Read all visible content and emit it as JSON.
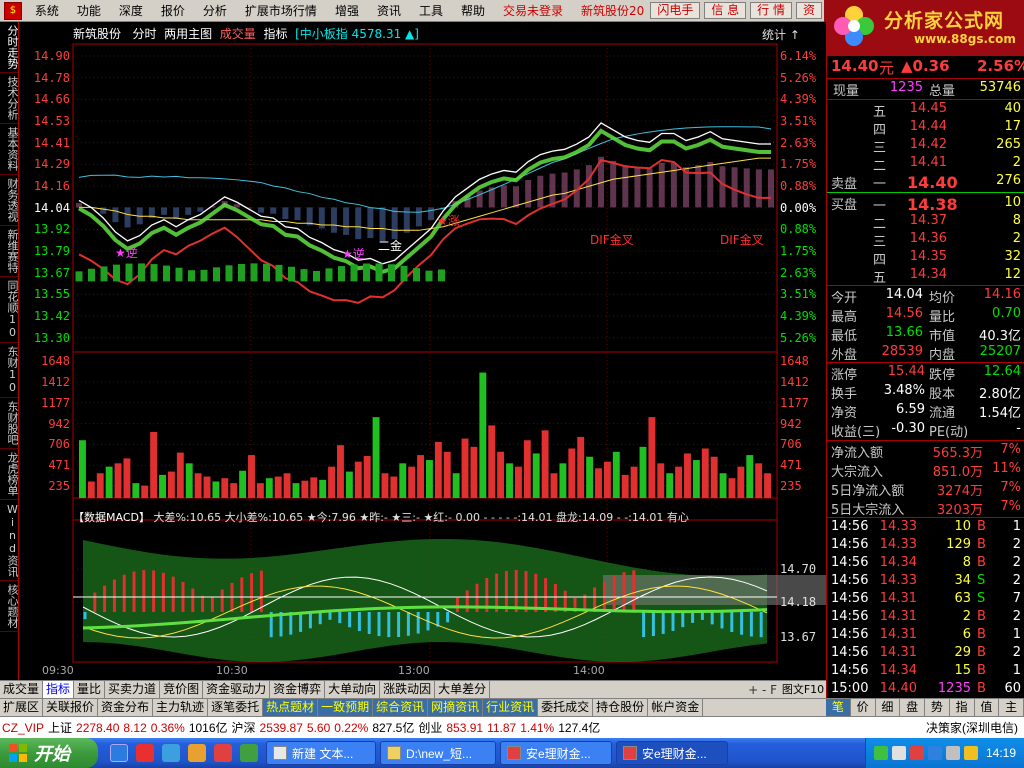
{
  "menubar": {
    "items": [
      "系统",
      "功能",
      "深度",
      "报价",
      "分析",
      "扩展市场行情",
      "增强",
      "资讯",
      "工具",
      "帮助"
    ],
    "trade_status": "交易未登录",
    "stock_tab": "新筑股份",
    "stock_tab_suffix": "20",
    "buttons": [
      "闪电手",
      "信 息",
      "行 情",
      "资"
    ]
  },
  "brand": {
    "title": "分析家公式网",
    "url": "www.88gs.com"
  },
  "leftnav": {
    "tabs": [
      "分时走势",
      "技术分析",
      "基本资料",
      "财务透视",
      "新维赛特",
      "同花顺10",
      "东财10",
      "东财股吧",
      "龙虎榜单",
      "Wind资讯",
      "核心题材"
    ]
  },
  "chart_header": {
    "stock": "新筑股份",
    "items": [
      "分时",
      "两用主图",
      "成交量",
      "指标"
    ],
    "index": "[中小板指 4578.31 ▲]",
    "stats": "统计 ↑"
  },
  "chart_data": {
    "type": "line",
    "price_axis": [
      "14.90",
      "14.78",
      "14.66",
      "14.53",
      "14.41",
      "14.29",
      "14.16",
      "14.04",
      "13.92",
      "13.79",
      "13.67",
      "13.55",
      "13.42",
      "13.30"
    ],
    "pct_axis": [
      "6.14%",
      "5.26%",
      "4.39%",
      "3.51%",
      "2.63%",
      "1.75%",
      "0.88%",
      "0.00%",
      "0.88%",
      "1.75%",
      "2.63%",
      "3.51%",
      "4.39%",
      "5.26%"
    ],
    "volume_axis": [
      "1648",
      "1412",
      "1177",
      "942",
      "706",
      "471",
      "235"
    ],
    "macd_axis": [
      "14.70",
      "14.18",
      "13.67"
    ],
    "time_labels": [
      "09:30",
      "10:30",
      "13:00",
      "14:00"
    ],
    "prev_close": 14.04,
    "price_series": [
      14.08,
      14.04,
      13.98,
      13.9,
      13.85,
      13.88,
      13.94,
      13.97,
      13.93,
      13.97,
      14.0,
      14.05,
      14.1,
      14.07,
      14.03,
      13.99,
      13.98,
      13.93,
      13.92,
      13.87,
      13.84,
      13.8,
      13.78,
      13.74,
      13.75,
      13.72,
      13.74,
      13.8,
      13.86,
      13.92,
      14.02,
      14.1,
      14.15,
      14.2,
      14.23,
      14.25,
      14.24,
      14.3,
      14.34,
      14.36,
      14.37,
      14.4,
      14.44,
      14.52,
      14.48,
      14.44,
      14.42,
      14.41,
      14.46,
      14.46,
      14.42,
      14.44,
      14.47,
      14.43,
      14.42,
      14.41,
      14.4,
      14.4
    ],
    "avg_series": [
      14.04,
      14.04,
      14.03,
      14.02,
      14.0,
      13.99,
      13.99,
      13.98,
      13.98,
      13.97,
      13.97,
      13.97,
      13.97,
      13.97,
      13.97,
      13.97,
      13.96,
      13.96,
      13.95,
      13.95,
      13.94,
      13.94,
      13.93,
      13.93,
      13.92,
      13.92,
      13.91,
      13.91,
      13.91,
      13.92,
      13.93,
      13.95,
      13.97,
      13.99,
      14.01,
      14.03,
      14.05,
      14.07,
      14.09,
      14.11,
      14.12,
      14.14,
      14.16,
      14.18,
      14.2,
      14.21,
      14.22,
      14.23,
      14.24,
      14.25,
      14.26,
      14.27,
      14.28,
      14.29,
      14.3,
      14.31,
      14.32,
      14.32
    ],
    "annotations": [
      "★逆",
      "★逆",
      "二金",
      "★涨",
      "DIF金叉",
      "DIF金叉"
    ],
    "volume_bars": [
      700,
      200,
      300,
      380,
      420,
      480,
      180,
      150,
      800,
      280,
      320,
      550,
      420,
      300,
      260,
      200,
      240,
      180,
      330,
      520,
      180,
      240,
      260,
      300,
      180,
      210,
      250,
      220,
      380,
      640,
      320,
      440,
      510,
      980,
      300,
      260,
      420,
      380,
      520,
      460,
      680,
      560,
      300,
      720,
      620,
      1520,
      880,
      560,
      420,
      380,
      700,
      540,
      820,
      300,
      420,
      600,
      740,
      500,
      360,
      440,
      560,
      280,
      380,
      620,
      980,
      420,
      300,
      380,
      540,
      460,
      600,
      500,
      300,
      240,
      380,
      520,
      420,
      300
    ],
    "macd_header": {
      "title": "【数据MACD】",
      "items": [
        "大差%:10.65",
        "大小差%:10.65",
        "★今:7.96",
        "★昨:-",
        "★三:-",
        "★红:-",
        "0.00",
        "-",
        "-",
        "-",
        "-",
        "-:14.01",
        "盘龙:14.09",
        "-",
        "-:14.01",
        "有心"
      ]
    }
  },
  "bottom_tabs_1": [
    "成交量",
    "指标",
    "量比",
    "买卖力道",
    "竞价图",
    "资金驱动力",
    "资金博弈",
    "大单动向",
    "涨跌动因",
    "大单差分"
  ],
  "bottom_tabs_1_nav": "+ - F",
  "bottom_tabs_2": [
    "扩展区",
    "关联报价",
    "资金分布",
    "主力轨迹",
    "逐笔委托",
    "热点题材",
    "一致预期",
    "综合资讯",
    "网摘资讯",
    "行业资讯",
    "委托成交",
    "持仓股份",
    "帐户资金"
  ],
  "quote": {
    "price": "14.40",
    "unit": "元",
    "change": "▲0.36",
    "pct": "2.56%",
    "now_vol_label": "现量",
    "now_vol": "1235",
    "total_vol_label": "总量",
    "total_vol": "53746",
    "asks": [
      {
        "label": "五",
        "price": "14.45",
        "vol": "40"
      },
      {
        "label": "四",
        "price": "14.44",
        "vol": "17"
      },
      {
        "label": "三",
        "price": "14.42",
        "vol": "265"
      },
      {
        "label": "二",
        "price": "14.41",
        "vol": "2"
      },
      {
        "label": "一",
        "price": "14.40",
        "vol": "276"
      }
    ],
    "bids": [
      {
        "label": "一",
        "price": "14.38",
        "vol": "10"
      },
      {
        "label": "二",
        "price": "14.37",
        "vol": "8"
      },
      {
        "label": "三",
        "price": "14.36",
        "vol": "2"
      },
      {
        "label": "四",
        "price": "14.35",
        "vol": "32"
      },
      {
        "label": "五",
        "price": "14.34",
        "vol": "12"
      }
    ],
    "ask_label": "卖盘",
    "bid_label": "买盘",
    "stats": [
      [
        "今开",
        "14.04",
        "均价",
        "14.16"
      ],
      [
        "最高",
        "14.56",
        "量比",
        "0.70"
      ],
      [
        "最低",
        "13.66",
        "市值",
        "40.3亿"
      ],
      [
        "外盘",
        "28539",
        "内盘",
        "25207"
      ]
    ],
    "stats2": [
      [
        "涨停",
        "15.44",
        "跌停",
        "12.64"
      ],
      [
        "换手",
        "3.48%",
        "股本",
        "2.80亿"
      ],
      [
        "净资",
        "6.59",
        "流通",
        "1.54亿"
      ],
      [
        "收益(三)",
        "-0.30",
        "PE(动)",
        "-"
      ]
    ],
    "flows": [
      [
        "净流入额",
        "565.3万",
        "7%"
      ],
      [
        "大宗流入",
        "851.0万",
        "11%"
      ],
      [
        "5日净流入额",
        "3274万",
        "7%"
      ],
      [
        "5日大宗流入",
        "3203万",
        "7%"
      ]
    ],
    "ticks": [
      [
        "14:56",
        "14.33",
        "10",
        "B",
        "1"
      ],
      [
        "14:56",
        "14.33",
        "129",
        "B",
        "2"
      ],
      [
        "14:56",
        "14.34",
        "8",
        "B",
        "2"
      ],
      [
        "14:56",
        "14.33",
        "34",
        "S",
        "2"
      ],
      [
        "14:56",
        "14.31",
        "63",
        "S",
        "7"
      ],
      [
        "14:56",
        "14.31",
        "2",
        "B",
        "2"
      ],
      [
        "14:56",
        "14.31",
        "6",
        "B",
        "1"
      ],
      [
        "14:56",
        "14.31",
        "29",
        "B",
        "2"
      ],
      [
        "14:56",
        "14.34",
        "15",
        "B",
        "1"
      ],
      [
        "15:00",
        "14.40",
        "1235",
        "B",
        "60"
      ]
    ]
  },
  "rp_tabs": [
    "笔",
    "价",
    "细",
    "盘",
    "势",
    "指",
    "值",
    "主"
  ],
  "rp_tab_hint": "图文F10",
  "ticker": {
    "items": [
      {
        "t": "CZ_VIP",
        "c": "#c00"
      },
      {
        "t": "上证",
        "c": "#000"
      },
      {
        "t": "2278.40",
        "c": "#c00"
      },
      {
        "t": "8.12",
        "c": "#c00"
      },
      {
        "t": "0.36%",
        "c": "#c00"
      },
      {
        "t": "1016亿",
        "c": "#000"
      },
      {
        "t": "沪深",
        "c": "#000"
      },
      {
        "t": "2539.87",
        "c": "#c00"
      },
      {
        "t": "5.60",
        "c": "#c00"
      },
      {
        "t": "0.22%",
        "c": "#c00"
      },
      {
        "t": "827.5亿",
        "c": "#000"
      },
      {
        "t": "创业",
        "c": "#000"
      },
      {
        "t": "853.91",
        "c": "#c00"
      },
      {
        "t": "11.87",
        "c": "#c00"
      },
      {
        "t": "1.41%",
        "c": "#c00"
      },
      {
        "t": "127.4亿",
        "c": "#000"
      }
    ],
    "right": "决策家(深圳电信)"
  },
  "taskbar": {
    "start": "开始",
    "tasks": [
      "新建 文本...",
      "D:\\new_短...",
      "安e理财金...",
      "安e理财金..."
    ],
    "clock": "14:19"
  }
}
